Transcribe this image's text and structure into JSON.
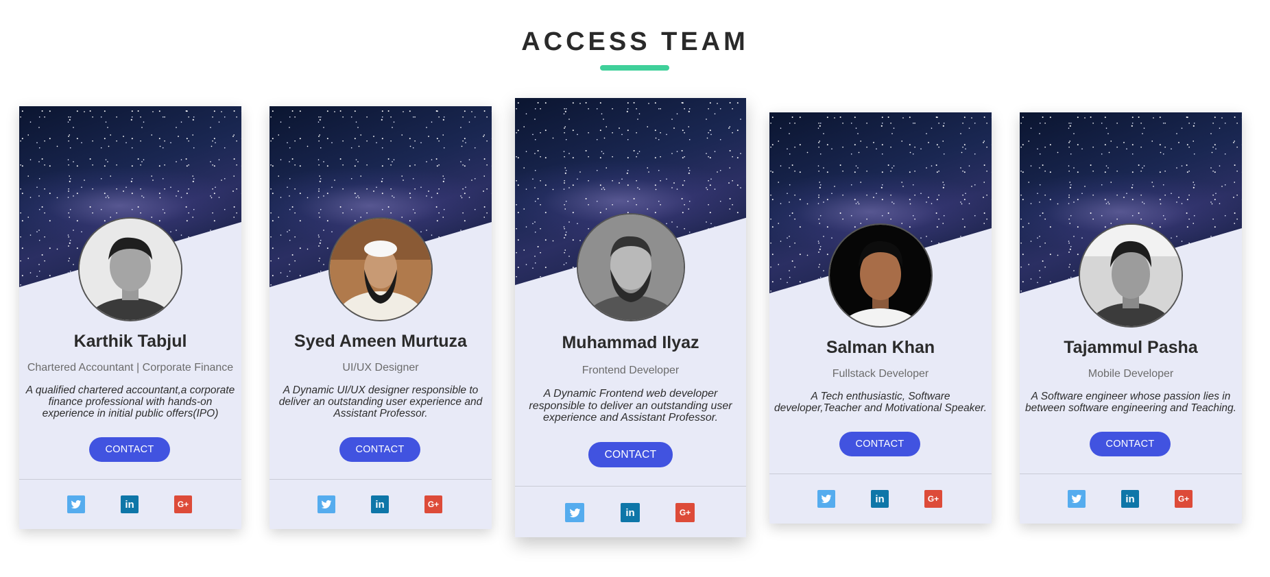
{
  "section": {
    "title": "ACCESS TEAM"
  },
  "colors": {
    "accent_underline": "#3fd09a",
    "button": "#4153e0",
    "card_background": "#e8eaf7",
    "twitter": "#55acee",
    "linkedin": "#0e76a8",
    "google_plus": "#dd4b39"
  },
  "members": [
    {
      "name": "Karthik Tabjul",
      "role": "Chartered Accountant | Corporate Finance",
      "bio": "A qualified chartered accountant,a corporate finance professional with hands-on experience in initial public offers(IPO)",
      "contact_label": "CONTACT"
    },
    {
      "name": "Syed Ameen Murtuza",
      "role": "UI/UX Designer",
      "bio": "A Dynamic UI/UX designer responsible to deliver an outstanding user experience and Assistant Professor.",
      "contact_label": "CONTACT"
    },
    {
      "name": "Muhammad Ilyaz",
      "role": "Frontend Developer",
      "bio": "A Dynamic Frontend web developer responsible to deliver an outstanding user experience and Assistant Professor.",
      "contact_label": "CONTACT"
    },
    {
      "name": "Salman Khan",
      "role": "Fullstack Developer",
      "bio": "A Tech enthusiastic, Software developer,Teacher and Motivational Speaker.",
      "contact_label": "CONTACT"
    },
    {
      "name": "Tajammul Pasha",
      "role": "Mobile Developer",
      "bio": "A Software engineer whose passion lies in between software engineering and Teaching.",
      "contact_label": "CONTACT"
    }
  ],
  "social_icons": [
    "twitter-icon",
    "linkedin-icon",
    "google-plus-icon"
  ]
}
